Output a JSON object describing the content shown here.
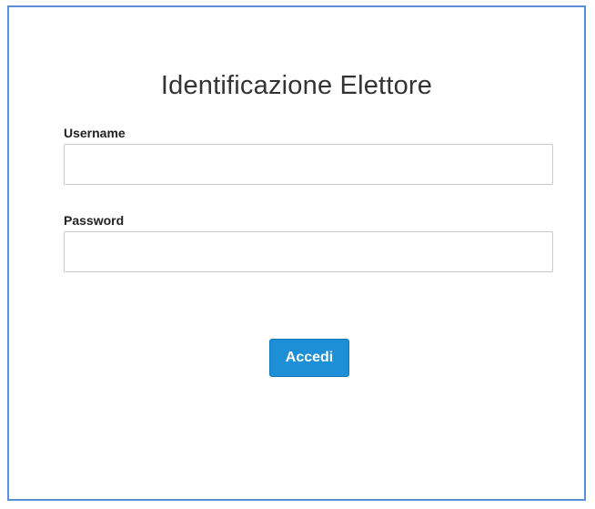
{
  "form": {
    "title": "Identificazione Elettore",
    "username_label": "Username",
    "username_value": "",
    "password_label": "Password",
    "password_value": "",
    "submit_label": "Accedi"
  },
  "colors": {
    "frame_border": "#5b8fd6",
    "button_bg": "#1c8fd6",
    "button_text": "#ffffff",
    "input_border": "#c8c8c8"
  }
}
